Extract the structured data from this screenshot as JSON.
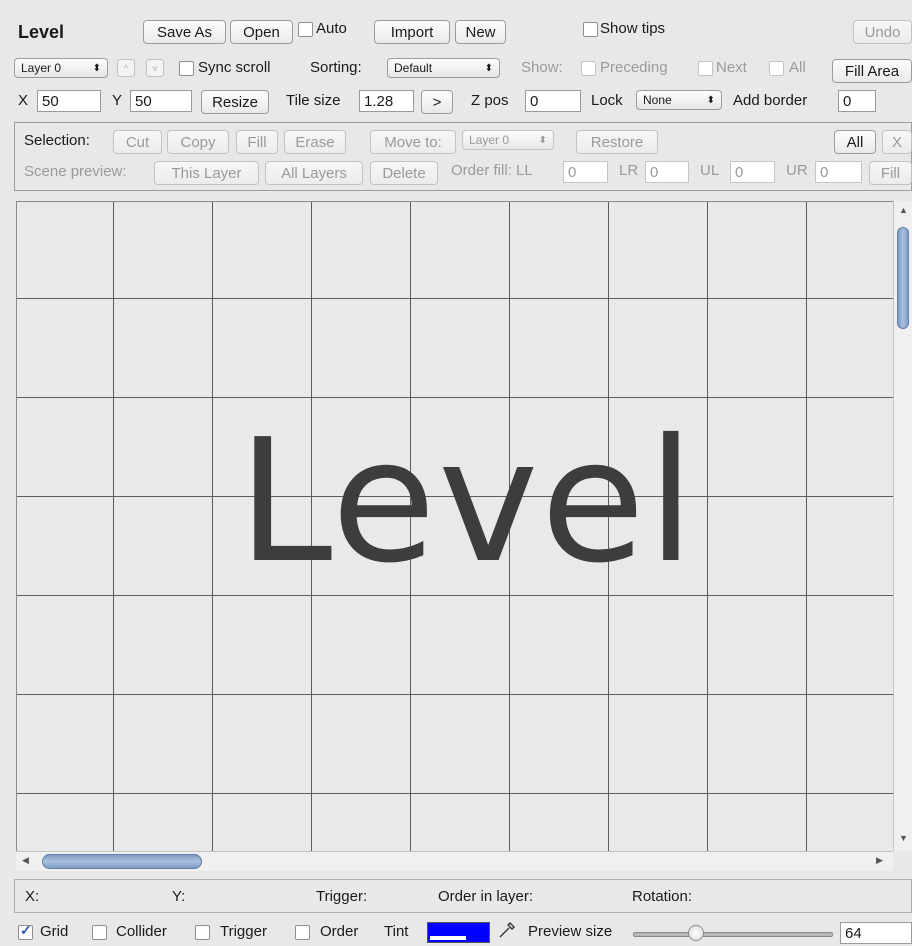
{
  "title": "Level",
  "toolbar1": {
    "save_as": "Save As",
    "open": "Open",
    "auto": "Auto",
    "import": "Import",
    "new": "New",
    "show_tips": "Show tips",
    "undo": "Undo"
  },
  "toolbar2": {
    "layer_select": "Layer 0",
    "up_arrow": "^",
    "down_arrow": "v",
    "sync_scroll": "Sync scroll",
    "sorting_label": "Sorting:",
    "sorting_value": "Default",
    "show_label": "Show:",
    "preceding": "Preceding",
    "next": "Next",
    "all": "All",
    "fill_area": "Fill Area"
  },
  "toolbar3": {
    "x_label": "X",
    "x_value": "50",
    "y_label": "Y",
    "y_value": "50",
    "resize": "Resize",
    "tile_size_label": "Tile size",
    "tile_size_value": "1.28",
    "tile_arrow": ">",
    "zpos_label": "Z pos",
    "zpos_value": "0",
    "lock_label": "Lock",
    "lock_value": "None",
    "add_border_label": "Add border",
    "add_border_value": "0"
  },
  "selection": {
    "label": "Selection:",
    "cut": "Cut",
    "copy": "Copy",
    "fill": "Fill",
    "erase": "Erase",
    "move_to": "Move to:",
    "move_layer": "Layer 0",
    "restore": "Restore",
    "all": "All",
    "x": "X"
  },
  "scene": {
    "label": "Scene preview:",
    "this_layer": "This Layer",
    "all_layers": "All Layers",
    "delete": "Delete",
    "order_fill": "Order fill: LL",
    "ll_value": "0",
    "lr_label": "LR",
    "lr_value": "0",
    "ul_label": "UL",
    "ul_value": "0",
    "ur_label": "UR",
    "ur_value": "0",
    "fill": "Fill"
  },
  "canvas": {
    "watermark": "Level"
  },
  "status": {
    "x": "X:",
    "y": "Y:",
    "trigger": "Trigger:",
    "order_in_layer": "Order in layer:",
    "rotation": "Rotation:"
  },
  "bottom": {
    "grid": "Grid",
    "collider": "Collider",
    "trigger": "Trigger",
    "order": "Order",
    "tint": "Tint",
    "tint_color": "#0000ff",
    "preview_size_label": "Preview size",
    "preview_size_value": "64"
  }
}
